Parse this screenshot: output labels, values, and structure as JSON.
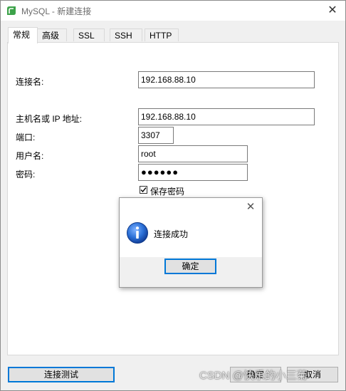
{
  "window": {
    "title": "MySQL - 新建连接",
    "close_glyph": "✕"
  },
  "tabs": [
    {
      "label": "常规",
      "active": true
    },
    {
      "label": "高级",
      "active": false
    },
    {
      "label": "SSL",
      "active": false
    },
    {
      "label": "SSH",
      "active": false
    },
    {
      "label": "HTTP",
      "active": false
    }
  ],
  "form": {
    "connection_name": {
      "label": "连接名:",
      "value": "192.168.88.10"
    },
    "host": {
      "label": "主机名或 IP 地址:",
      "value": "192.168.88.10"
    },
    "port": {
      "label": "端口:",
      "value": "3307"
    },
    "username": {
      "label": "用户名:",
      "value": "root"
    },
    "password": {
      "label": "密码:",
      "value": "●●●●●●"
    },
    "save_password": {
      "label": "保存密码",
      "checked": true
    }
  },
  "message_box": {
    "close_glyph": "✕",
    "icon": "info-icon",
    "text": "连接成功",
    "ok_label": "确定"
  },
  "footer": {
    "test_button_label": "连接测试",
    "ok_button_label": "确定",
    "cancel_button_label": "取消"
  },
  "watermark": "CSDN @快乐的小三菊",
  "colors": {
    "accent": "#0078d7",
    "navicat_green": "#3da34a",
    "info_blue": "#1c5cc0"
  }
}
